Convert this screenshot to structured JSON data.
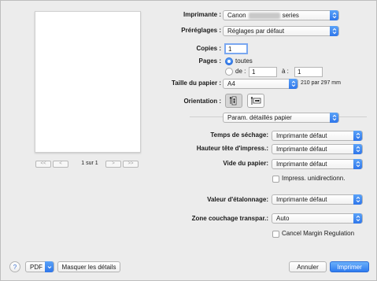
{
  "preview": {
    "page_text": "1 sur 1",
    "nav": {
      "first": "<<",
      "prev": "<",
      "next": ">",
      "last": ">>"
    }
  },
  "printer": {
    "label": "Imprimante :",
    "value_prefix": "Canon",
    "value_suffix": "series"
  },
  "presets": {
    "label": "Préréglages :",
    "value": "Réglages par défaut"
  },
  "copies": {
    "label": "Copies :",
    "value": "1"
  },
  "pages": {
    "label": "Pages :",
    "all_label": "toutes",
    "from_label": "de :",
    "from_value": "1",
    "to_label": "à :",
    "to_value": "1",
    "selected": "all"
  },
  "paper_size": {
    "label": "Taille du papier :",
    "value": "A4",
    "dimensions": "210 par 297 mm"
  },
  "orientation": {
    "label": "Orientation :",
    "selected": "portrait"
  },
  "section_popup": {
    "value": "Param. détaillés papier"
  },
  "settings": {
    "drying_time": {
      "label": "Temps de séchage:",
      "value": "Imprimante défaut"
    },
    "head_height": {
      "label": "Hauteur tête d'impress.:",
      "value": "Imprimante défaut"
    },
    "paper_vacuum": {
      "label": "Vide du papier:",
      "value": "Imprimante défaut"
    },
    "unidirectional": {
      "label": "Impress. unidirectionn.",
      "checked": false
    },
    "calibration": {
      "label": "Valeur d'étalonnage:",
      "value": "Imprimante défaut"
    },
    "transparent_coating": {
      "label": "Zone couchage transpar.:",
      "value": "Auto"
    },
    "cancel_margin": {
      "label": "Cancel Margin Regulation",
      "checked": false
    }
  },
  "footer": {
    "help": "?",
    "pdf": "PDF",
    "hide_details": "Masquer les détails",
    "cancel": "Annuler",
    "print": "Imprimer"
  },
  "colors": {
    "accent": "#2f76ea",
    "window_bg": "#ececec"
  }
}
